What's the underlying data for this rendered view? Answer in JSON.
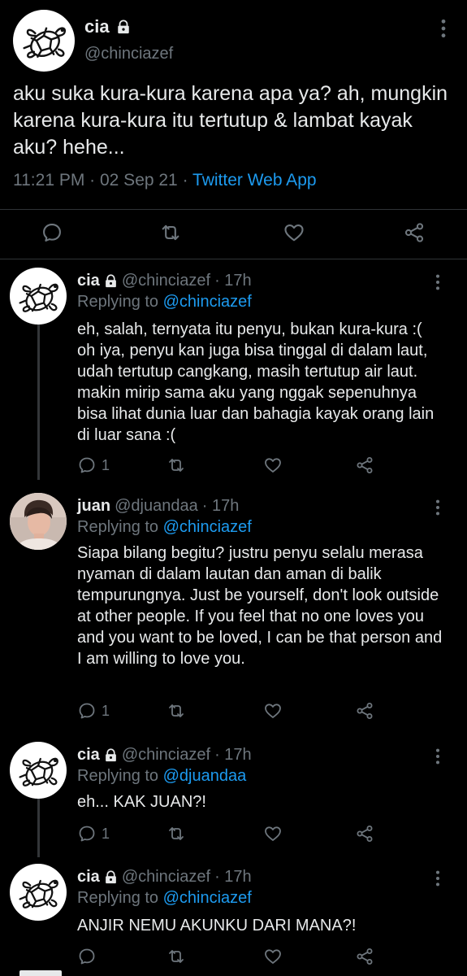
{
  "main": {
    "name": "cia",
    "handle": "@chinciazef",
    "text": "aku suka kura-kura karena apa ya? ah, mungkin karena kura-kura itu tertutup & lambat kayak aku? hehe...",
    "time": "11:21 PM · 02 Sep 21 · ",
    "source": "Twitter Web App"
  },
  "replies": [
    {
      "name": "cia",
      "handle": "@chinciazef",
      "age": "· 17h",
      "replying_prefix": "Replying to ",
      "replying_to": "@chinciazef",
      "text": "eh, salah, ternyata itu penyu, bukan kura-kura :( oh iya, penyu kan juga bisa tinggal di dalam laut, udah tertutup cangkang, masih tertutup air laut. makin mirip sama aku yang nggak sepenuhnya bisa lihat dunia luar dan bahagia kayak orang lain di luar sana :(",
      "reply_count": "1"
    },
    {
      "name": "juan",
      "handle": "@djuandaa",
      "age": "· 17h",
      "replying_prefix": "Replying to ",
      "replying_to": "@chinciazef",
      "text": "Siapa bilang begitu? justru penyu selalu merasa nyaman di dalam lautan dan aman di balik tempurungnya. Just be yourself, don't look outside at other people.  If you feel that no one loves you and you want to be loved, I can be that person and I am willing to love you.",
      "reply_count": "1"
    },
    {
      "name": "cia",
      "handle": "@chinciazef",
      "age": "· 17h",
      "replying_prefix": "Replying to ",
      "replying_to": "@djuandaa",
      "text": "eh... KAK JUAN?!",
      "reply_count": "1"
    },
    {
      "name": "cia",
      "handle": "@chinciazef",
      "age": "· 17h",
      "replying_prefix": "Replying to ",
      "replying_to": "@chinciazef",
      "text": "ANJIR NEMU AKUNKU DARI MANA?!",
      "reply_count": ""
    }
  ],
  "colors": {
    "background": "#000000",
    "link": "#1d9bf0",
    "muted": "#6e767d"
  },
  "icons": [
    "turtle-avatar-icon",
    "lock-icon",
    "more-icon",
    "reply-icon",
    "retweet-icon",
    "like-icon",
    "share-icon"
  ]
}
